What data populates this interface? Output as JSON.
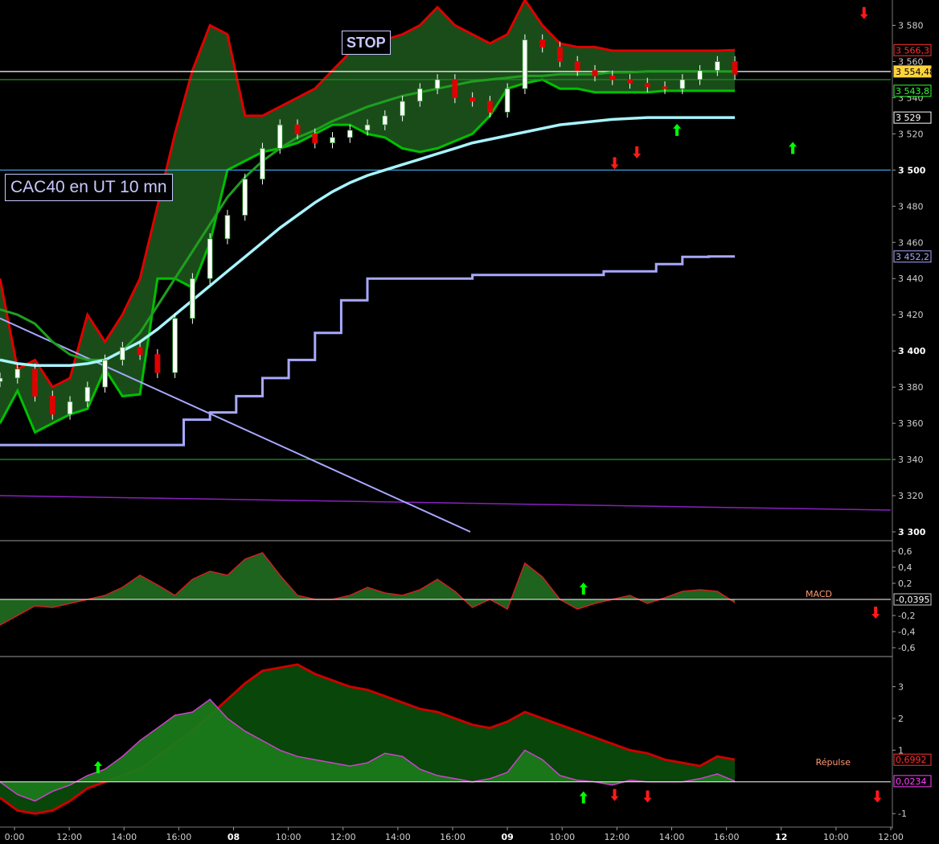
{
  "title": "CAC40 en UT 10 mn",
  "stop_label": "STOP",
  "colors": {
    "up": "#00c000",
    "down": "#e00000",
    "bb_fill_green": "#2f8a2f",
    "bb_fill_red": "#8b0000",
    "ma_green": "#1f9f1f",
    "ma_cyan": "#a8f4ff",
    "ma_lavender": "#a8a8ff",
    "hline_blue": "#3aa0e0",
    "hline_green": "#1c8a1c",
    "purple": "#8a20c0"
  },
  "chart_data": [
    {
      "type": "candlestick",
      "title": "CAC40 en UT 10 mn",
      "ylim": [
        3296,
        3594
      ],
      "yticks": [
        3300,
        3320,
        3340,
        3360,
        3380,
        3400,
        3420,
        3440,
        3460,
        3480,
        3500,
        3520,
        3540,
        3560,
        3580
      ],
      "bold_yticks": [
        3300,
        3400,
        3500
      ],
      "hlines": [
        {
          "value": 3500,
          "color": "#3aa0e0"
        },
        {
          "value": 3340,
          "color": "#1c8a1c"
        },
        {
          "value": 3550,
          "color": "#1c8a1c"
        },
        {
          "value": 3554.48,
          "color": "#ffffff"
        }
      ],
      "price_labels": [
        {
          "text": "3 566,3",
          "value": 3566.3,
          "color": "#ff3030"
        },
        {
          "text": "3 554,48",
          "value": 3554.48,
          "color": "#ffd23c"
        },
        {
          "text": "3 543,8",
          "value": 3543.8,
          "color": "#30ff30"
        },
        {
          "text": "3 529",
          "value": 3529,
          "color": "#ffffff"
        },
        {
          "text": "3 452,2",
          "value": 3452.2,
          "color": "#a8a8ff"
        }
      ],
      "x_labels": [
        "0:00",
        "12:00",
        "14:00",
        "16:00",
        "08",
        "10:00",
        "12:00",
        "14:00",
        "16:00",
        "09",
        "10:00",
        "12:00",
        "14:00",
        "16:00",
        "12",
        "10:00",
        "12:00"
      ],
      "bold_x_labels": [
        "08",
        "09",
        "12"
      ],
      "close": [
        3385,
        3390,
        3375,
        3365,
        3372,
        3380,
        3395,
        3402,
        3398,
        3388,
        3418,
        3440,
        3462,
        3475,
        3495,
        3512,
        3525,
        3520,
        3515,
        3518,
        3522,
        3525,
        3530,
        3538,
        3545,
        3550,
        3540,
        3538,
        3532,
        3545,
        3572,
        3568,
        3560,
        3555,
        3552,
        3550,
        3548,
        3546,
        3545,
        3550,
        3555,
        3560,
        3553
      ],
      "bb_upper": [
        3440,
        3390,
        3395,
        3380,
        3385,
        3420,
        3405,
        3420,
        3440,
        3480,
        3520,
        3555,
        3580,
        3575,
        3530,
        3530,
        3535,
        3540,
        3545,
        3555,
        3565,
        3565,
        3572,
        3575,
        3580,
        3590,
        3580,
        3575,
        3570,
        3575,
        3594,
        3580,
        3570,
        3568,
        3568,
        3566,
        3566,
        3566,
        3566,
        3566,
        3566,
        3566,
        3566.3
      ],
      "bb_lower": [
        3360,
        3378,
        3355,
        3360,
        3365,
        3368,
        3390,
        3375,
        3376,
        3440,
        3440,
        3435,
        3460,
        3500,
        3505,
        3510,
        3512,
        3515,
        3520,
        3525,
        3525,
        3520,
        3518,
        3512,
        3510,
        3512,
        3516,
        3520,
        3530,
        3545,
        3548,
        3550,
        3545,
        3545,
        3543,
        3543,
        3543,
        3543,
        3543.8,
        3543.8,
        3543.8,
        3543.8,
        3543.8
      ],
      "ma_cyan": [
        3395,
        3393,
        3392,
        3392,
        3392,
        3393,
        3395,
        3400,
        3405,
        3412,
        3420,
        3428,
        3436,
        3444,
        3452,
        3460,
        3468,
        3475,
        3482,
        3488,
        3493,
        3497,
        3500,
        3503,
        3506,
        3509,
        3512,
        3515,
        3517,
        3519,
        3521,
        3523,
        3525,
        3526,
        3527,
        3528,
        3528.5,
        3529,
        3529,
        3529,
        3529,
        3529,
        3529
      ],
      "ma_green_long": [
        3423,
        3420,
        3415,
        3405,
        3398,
        3395,
        3395,
        3400,
        3410,
        3425,
        3440,
        3455,
        3470,
        3485,
        3496,
        3505,
        3512,
        3518,
        3522,
        3527,
        3531,
        3535,
        3538,
        3541,
        3543,
        3545,
        3547,
        3549,
        3550,
        3551,
        3552,
        3552,
        3553,
        3553,
        3553,
        3554,
        3554,
        3554.5,
        3554.5,
        3554.5,
        3554.5,
        3554.5,
        3554.48
      ],
      "ma_lavender_step": [
        3348,
        3348,
        3348,
        3348,
        3348,
        3348,
        3348,
        3362,
        3366,
        3375,
        3385,
        3395,
        3410,
        3428,
        3440,
        3440,
        3440,
        3440,
        3442,
        3442,
        3442,
        3442,
        3442,
        3444,
        3444,
        3448,
        3452,
        3452.2,
        3452.2
      ],
      "diagonal_line": {
        "from": 3418,
        "to": 3300
      },
      "purple_line": {
        "from": 3320,
        "to": 3312
      }
    },
    {
      "type": "area",
      "title": "MACD",
      "ylim": [
        -0.7,
        0.7
      ],
      "yticks": [
        0.6,
        0.4,
        0.2,
        -0.2,
        -0.4,
        -0.6
      ],
      "tick_labels": [
        "0,6",
        "0,4",
        "0,2",
        "-0,2",
        "-0,4",
        "-0,6"
      ],
      "value_label": "-0,0395",
      "values": [
        -0.32,
        -0.2,
        -0.08,
        -0.1,
        -0.05,
        0,
        0.05,
        0.15,
        0.3,
        0.18,
        0.05,
        0.25,
        0.35,
        0.3,
        0.5,
        0.58,
        0.3,
        0.05,
        0.0,
        0.0,
        0.05,
        0.15,
        0.08,
        0.05,
        0.12,
        0.25,
        0.1,
        -0.1,
        0.0,
        -0.12,
        0.45,
        0.28,
        0.0,
        -0.12,
        -0.05,
        0.0,
        0.05,
        -0.05,
        0.02,
        0.1,
        0.12,
        0.1,
        -0.04
      ]
    },
    {
      "type": "area",
      "title": "Répulse",
      "ylim": [
        -1.4,
        3.9
      ],
      "yticks": [
        3,
        2,
        1,
        -1
      ],
      "tick_labels": [
        "3",
        "2",
        "1",
        "-1"
      ],
      "value_labels": [
        {
          "text": "0,6992",
          "value": 0.6992,
          "color": "#ff3030"
        },
        {
          "text": "0,0234",
          "value": 0.0234,
          "color": "#ff40ff"
        }
      ],
      "series": [
        {
          "values": [
            -0.5,
            -0.9,
            -1.0,
            -0.9,
            -0.6,
            -0.2,
            0.0,
            0.2,
            0.4,
            0.8,
            1.2,
            1.6,
            2.1,
            2.6,
            3.1,
            3.5,
            3.6,
            3.7,
            3.4,
            3.2,
            3.0,
            2.9,
            2.7,
            2.5,
            2.3,
            2.2,
            2.0,
            1.8,
            1.7,
            1.9,
            2.2,
            2.0,
            1.8,
            1.6,
            1.4,
            1.2,
            1.0,
            0.9,
            0.7,
            0.6,
            0.5,
            0.8,
            0.6992
          ]
        },
        {
          "values": [
            0.0,
            -0.4,
            -0.6,
            -0.3,
            -0.1,
            0.2,
            0.4,
            0.8,
            1.3,
            1.7,
            2.1,
            2.2,
            2.6,
            2.0,
            1.6,
            1.3,
            1.0,
            0.8,
            0.7,
            0.6,
            0.5,
            0.6,
            0.9,
            0.8,
            0.4,
            0.2,
            0.1,
            0.0,
            0.1,
            0.3,
            1.0,
            0.7,
            0.2,
            0.05,
            0.0,
            -0.1,
            0.05,
            0.0,
            0.0,
            0.0,
            0.1,
            0.25,
            0.0234
          ]
        }
      ]
    }
  ],
  "arrows": [
    {
      "dir": "down",
      "panel": 0,
      "value": 3587,
      "at": 0.97
    },
    {
      "dir": "down",
      "panel": 0,
      "value": 3504,
      "at": 0.69
    },
    {
      "dir": "down",
      "panel": 0,
      "value": 3510,
      "at": 0.715
    },
    {
      "dir": "up",
      "panel": 0,
      "value": 3522,
      "at": 0.76
    },
    {
      "dir": "up",
      "panel": 0,
      "value": 3512,
      "at": 0.89
    },
    {
      "dir": "up",
      "panel": 1,
      "value": 0.13,
      "at": 0.655
    },
    {
      "dir": "down",
      "panel": 1,
      "value": -0.16,
      "at": 0.983
    },
    {
      "dir": "up",
      "panel": 2,
      "value": 0.45,
      "at": 0.11
    },
    {
      "dir": "up",
      "panel": 2,
      "value": -0.5,
      "at": 0.655
    },
    {
      "dir": "down",
      "panel": 2,
      "value": -0.4,
      "at": 0.69
    },
    {
      "dir": "down",
      "panel": 2,
      "value": -0.45,
      "at": 0.727
    },
    {
      "dir": "down",
      "panel": 2,
      "value": -0.45,
      "at": 0.985
    }
  ]
}
